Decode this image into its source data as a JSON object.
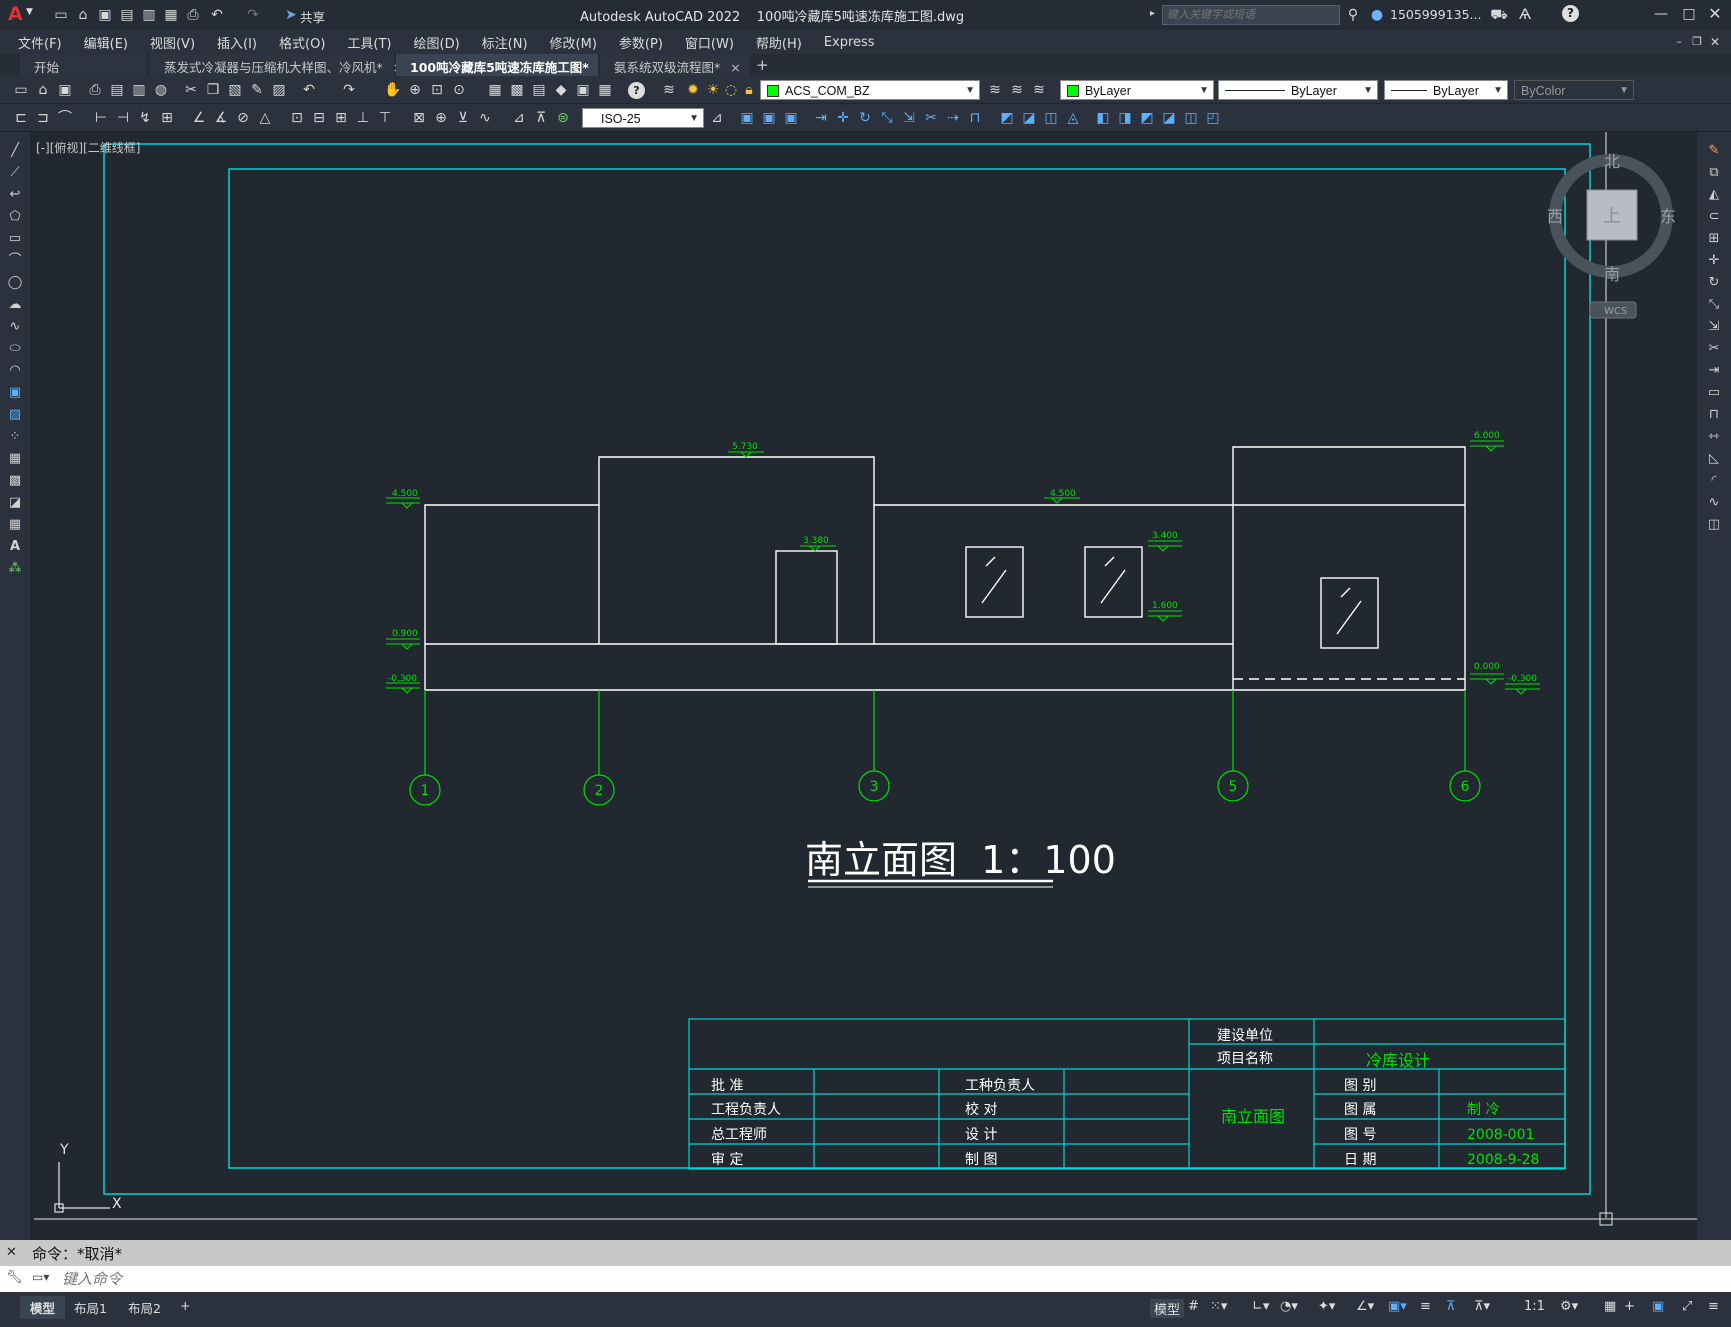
{
  "app": {
    "logo": "A",
    "title": "Autodesk AutoCAD 2022    100吨冷藏库5吨速冻库施工图.dwg",
    "share": "共享",
    "search_placeholder": "键入关键字或短语",
    "user": "1505999135...",
    "help": "?"
  },
  "menu": [
    "文件(F)",
    "编辑(E)",
    "视图(V)",
    "插入(I)",
    "格式(O)",
    "工具(T)",
    "绘图(D)",
    "标注(N)",
    "修改(M)",
    "参数(P)",
    "窗口(W)",
    "帮助(H)",
    "Express"
  ],
  "tabs": [
    {
      "label": "开始",
      "close": ""
    },
    {
      "label": "蒸发式冷凝器与压缩机大样图、冷风机*",
      "close": "×"
    },
    {
      "label": "100吨冷藏库5吨速冻库施工图*",
      "close": "×"
    },
    {
      "label": "氨系统双级流程图*",
      "close": "×"
    }
  ],
  "tab_add": "+",
  "toolbar": {
    "layer": "ACS_COM_BZ",
    "color": "ByLayer",
    "linetype": "ByLayer",
    "lineweight": "ByLayer",
    "plotstyle": "ByColor",
    "dimstyle": "ISO-25"
  },
  "viewport_label": "[-][俯视][二维线框]",
  "viewcube": {
    "north": "北",
    "south": "南",
    "east": "东",
    "west": "西",
    "top": "上",
    "wcs": "WCS"
  },
  "ucs": {
    "x": "X",
    "y": "Y"
  },
  "drawing": {
    "title": "南立面图  1：100",
    "levels": {
      "l4500a": "4.500",
      "l5730": "5.730",
      "l4500b": "4.500",
      "l6000": "6.000",
      "l3380": "3.380",
      "l3400": "3.400",
      "l1600": "1.600",
      "l0900": "0.900",
      "lm0300a": "-0.300",
      "l0000": "0.000",
      "lm0300b": "-0.300"
    },
    "axes": [
      "1",
      "2",
      "3",
      "5",
      "6"
    ]
  },
  "titleblock": {
    "jianshe": "建设单位",
    "xiangmu": "项目名称",
    "project_value": "冷库设计",
    "pizhun": "批      准",
    "gongcheng": "工程负责人",
    "zonggong": "总工程师",
    "shending": "审      定",
    "gongzhong": "工种负责人",
    "jiaodui": "校      对",
    "sheji": "设      计",
    "zhitu": "制      图",
    "drawing_name": "南立面图",
    "tubie": "图      别",
    "tushu": "图      属",
    "tuhao": "图      号",
    "riqi": "日      期",
    "tushu_val": "制      冷",
    "tuhao_val": "2008-001",
    "riqi_val": "2008-9-28"
  },
  "command": {
    "history": "命令：*取消*",
    "placeholder": "键入命令"
  },
  "layout_tabs": [
    "模型",
    "布局1",
    "布局2",
    "+"
  ],
  "status": {
    "model": "模型",
    "scale": "1:1"
  }
}
